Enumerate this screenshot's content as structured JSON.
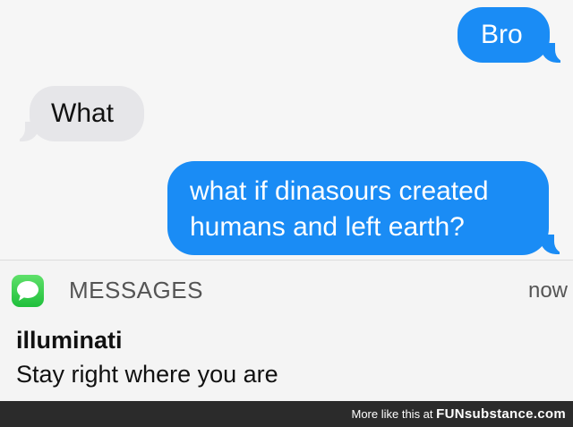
{
  "conversation": {
    "messages": [
      {
        "direction": "sent",
        "text": "Bro"
      },
      {
        "direction": "received",
        "text": "What"
      },
      {
        "direction": "sent",
        "lines": [
          "what if dinasours created",
          "humans and left earth?"
        ]
      }
    ]
  },
  "notification": {
    "app_icon": "speech-bubble-icon",
    "app_name": "MESSAGES",
    "time": "now",
    "sender": "illuminati",
    "body": "Stay right where you are"
  },
  "footer": {
    "prefix": "More like this at",
    "brand": "FUNsubstance.com"
  },
  "colors": {
    "sent_bubble": "#1a8cf5",
    "received_bubble": "#e6e6e9",
    "messages_icon": "#2ec74a"
  }
}
